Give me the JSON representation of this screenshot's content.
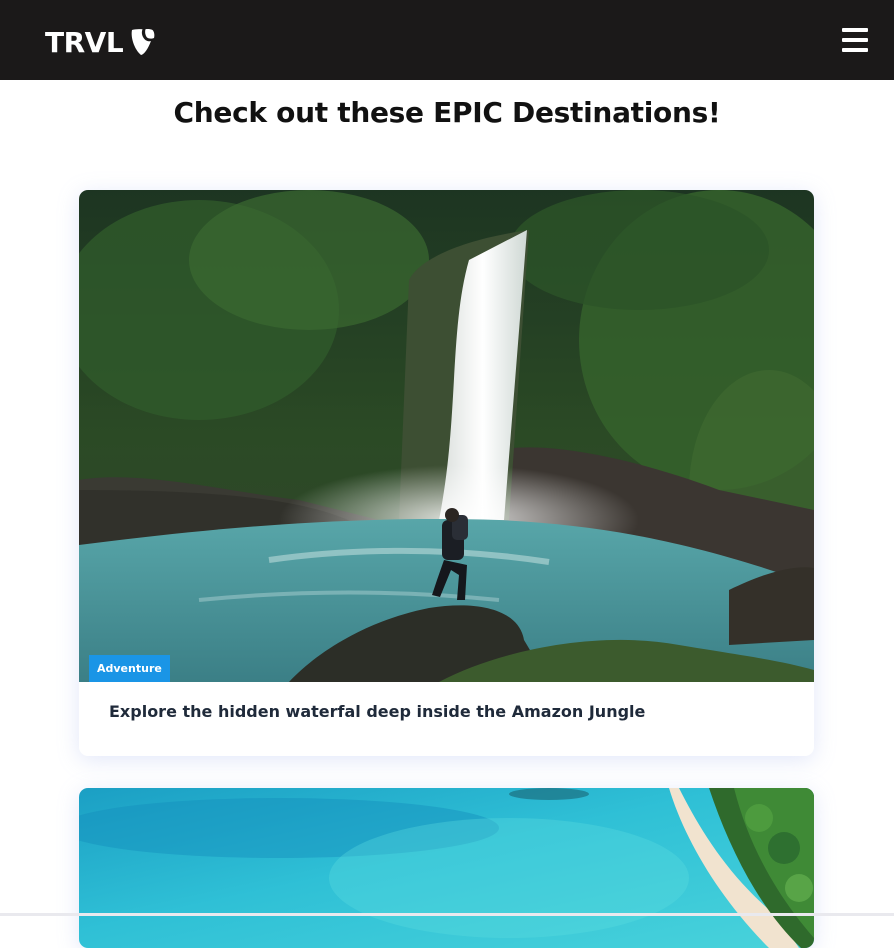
{
  "header": {
    "brand": "TRVL",
    "brand_icon": "typo3-logo-icon",
    "menu_icon": "hamburger-menu-icon",
    "background_color": "#1b1919"
  },
  "page": {
    "heading": "Check out these EPIC Destinations!"
  },
  "cards": [
    {
      "category": "Adventure",
      "title": "Explore the hidden waterfal deep inside the Amazon Jungle",
      "image": "waterfall-image",
      "badge_color": "#1a95e6"
    },
    {
      "image": "tropical-beach-image"
    }
  ]
}
